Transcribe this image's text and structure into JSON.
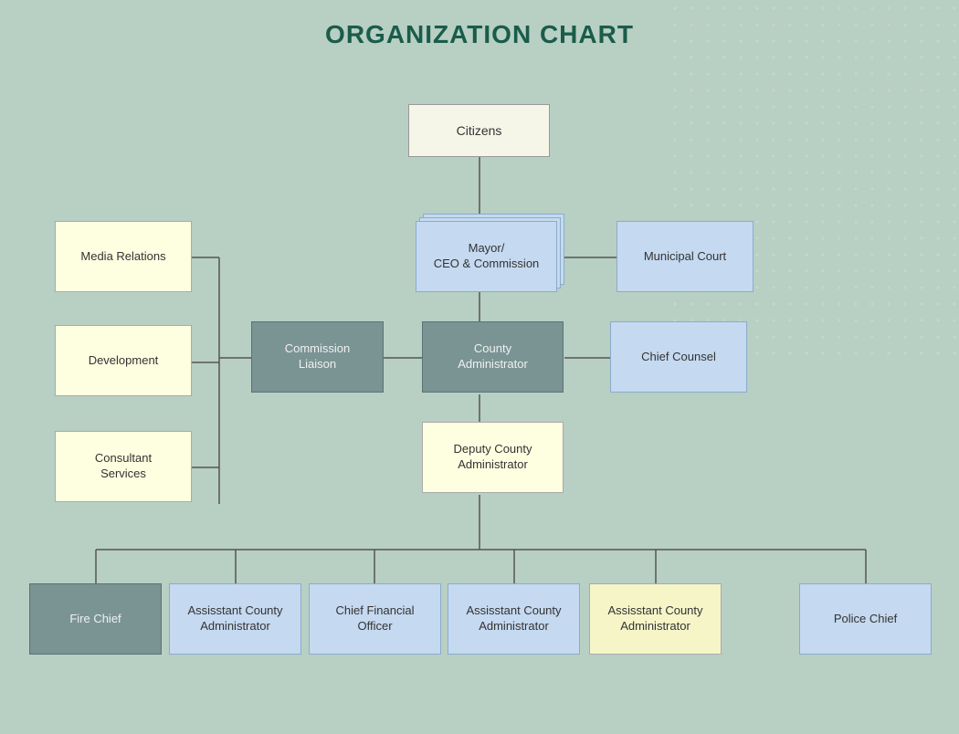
{
  "title": "ORGANIZATION CHART",
  "nodes": {
    "citizens": {
      "label": "Citizens"
    },
    "mayor": {
      "label": "Mayor/\nCEO & Commission"
    },
    "municipal_court": {
      "label": "Municipal Court"
    },
    "media_relations": {
      "label": "Media Relations"
    },
    "development": {
      "label": "Development"
    },
    "consultant_services": {
      "label": "Consultant\nServices"
    },
    "commission_liaison": {
      "label": "Commission\nLiaison"
    },
    "county_admin": {
      "label": "County\nAdministrator"
    },
    "chief_counsel": {
      "label": "Chief Counsel"
    },
    "deputy_county_admin": {
      "label": "Deputy County\nAdministrator"
    },
    "fire_chief": {
      "label": "Fire Chief"
    },
    "asst_admin_1": {
      "label": "Assisstant County\nAdministrator"
    },
    "cfo": {
      "label": "Chief Financial\nOfficer"
    },
    "asst_admin_2": {
      "label": "Assisstant County\nAdministrator"
    },
    "asst_admin_3": {
      "label": "Assisstant County\nAdministrator"
    },
    "police_chief": {
      "label": "Police Chief"
    }
  },
  "colors": {
    "background": "#b8cfc4",
    "title": "#1a5c4a",
    "node_white": "#f5f5e8",
    "node_blue": "#c5d9f0",
    "node_gray": "#7a9494",
    "node_yellow": "#f5f5c8",
    "node_lightyellow": "#fefee0",
    "line_color": "#555"
  }
}
